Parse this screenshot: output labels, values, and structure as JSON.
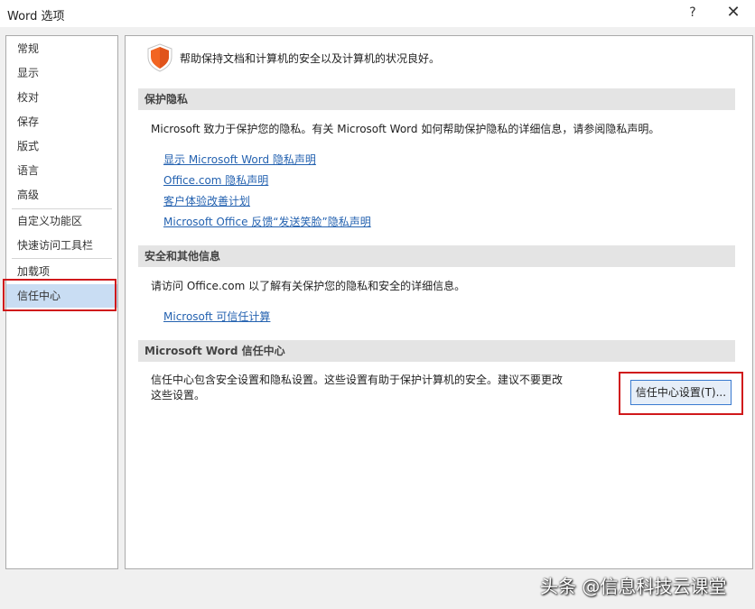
{
  "window": {
    "title": "Word 选项",
    "help": "?",
    "close": "✕"
  },
  "sidebar": {
    "items": [
      {
        "label": "常规"
      },
      {
        "label": "显示"
      },
      {
        "label": "校对"
      },
      {
        "label": "保存"
      },
      {
        "label": "版式"
      },
      {
        "label": "语言"
      },
      {
        "label": "高级"
      },
      {
        "label": "自定义功能区"
      },
      {
        "label": "快速访问工具栏"
      },
      {
        "label": "加载项"
      },
      {
        "label": "信任中心",
        "selected": true
      }
    ]
  },
  "main": {
    "intro": "帮助保持文档和计算机的安全以及计算机的状况良好。",
    "privacy": {
      "header": "保护隐私",
      "text": "Microsoft 致力于保护您的隐私。有关 Microsoft Word 如何帮助保护隐私的详细信息，请参阅隐私声明。",
      "links": [
        "显示 Microsoft Word 隐私声明",
        "Office.com 隐私声明",
        "客户体验改善计划",
        "Microsoft Office 反馈“发送笑脸”隐私声明"
      ]
    },
    "security": {
      "header": "安全和其他信息",
      "text": "请访问 Office.com 以了解有关保护您的隐私和安全的详细信息。",
      "link": "Microsoft 可信任计算"
    },
    "trust_center": {
      "header": "Microsoft Word 信任中心",
      "text_line1": "信任中心包含安全设置和隐私设置。这些设置有助于保护计算机的安全。建议不要更改",
      "text_line2": "这些设置。",
      "button": "信任中心设置(T)..."
    }
  },
  "watermark": "头条 @信息科技云课堂",
  "colors": {
    "accent": "#2462b0",
    "highlight": "#d0191b",
    "shield": "#f26522",
    "selected": "#c9ddf3"
  }
}
